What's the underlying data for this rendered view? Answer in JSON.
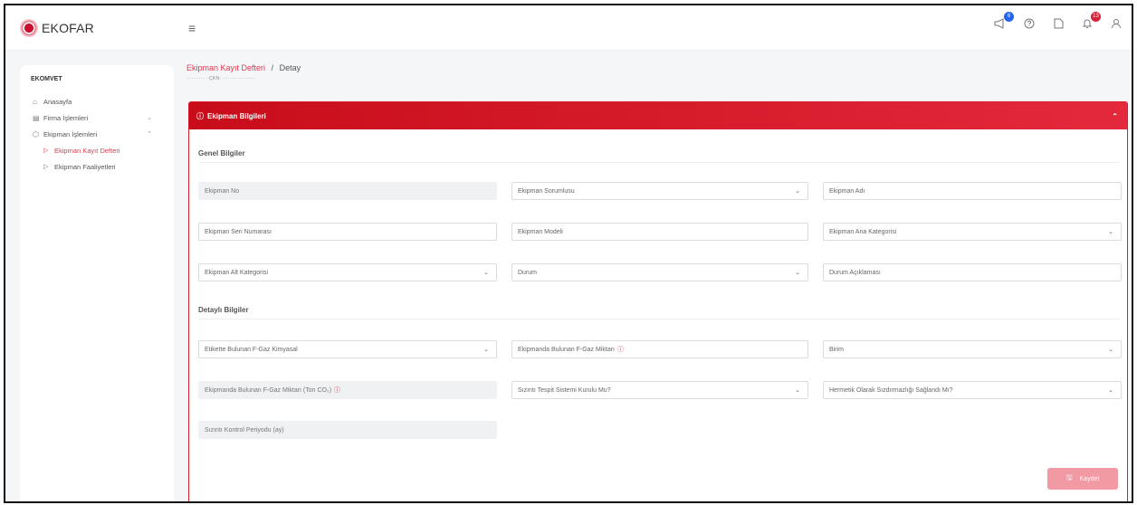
{
  "app": {
    "name": "EKOFAR"
  },
  "topbar": {
    "hamburger": "≡",
    "messages_badge": "6",
    "notifications_badge": "13"
  },
  "sidebar": {
    "section_title": "EKOMVET",
    "items": [
      {
        "label": "Anasayfa"
      },
      {
        "label": "Firma İşlemleri"
      },
      {
        "label": "Ekipman İşlemleri"
      }
    ],
    "sub_items": [
      {
        "label": "Ekipman Kayıt Defteri",
        "active": true
      },
      {
        "label": "Ekipman Faaliyetleri",
        "active": false
      }
    ]
  },
  "breadcrumb": {
    "parent": "Ekipman Kayıt Defteri",
    "separator": "/",
    "current": "Detay",
    "subline": "··········  · ÇKN: ··················"
  },
  "panel": {
    "title": "Ekipman Bilgileri",
    "sections": {
      "general": "Genel Bilgiler",
      "detailed": "Detaylı Bilgiler"
    },
    "fields": {
      "ekipman_no": "Ekipman No",
      "ekipman_sorumlusu": "Ekipman Sorumlusu",
      "ekipman_adi": "Ekipman Adı",
      "seri_numarasi": "Ekipman Seri Numarası",
      "ekipman_modeli": "Ekipman Modeli",
      "ana_kategori": "Ekipman Ana Kategorisi",
      "alt_kategori": "Ekipman Alt Kategorisi",
      "durum": "Durum",
      "durum_aciklamasi": "Durum Açıklaması",
      "etiket_kimyasal": "Etikette Bulunan F-Gaz Kimyasal",
      "fgaz_miktari": "Ekipmanda Bulunan F-Gaz Miktarı",
      "birim": "Birim",
      "fgaz_ton": "Ekipmanda Bulunan F-Gaz Miktarı (Ton CO₂)",
      "sizinti_tespit": "Sızıntı Tespit Sistemi Kurulu Mu?",
      "hermetik": "Hermetik Olarak Sızdırmazlığı Sağlandı Mı?",
      "sizinti_periyodu": "Sızıntı Kontrol Periyodu (ay)"
    },
    "save_label": "Kaydet"
  },
  "colors": {
    "accent": "#d71f2f",
    "active_link": "#e03a4d",
    "save_disabled": "#f19aa4"
  }
}
